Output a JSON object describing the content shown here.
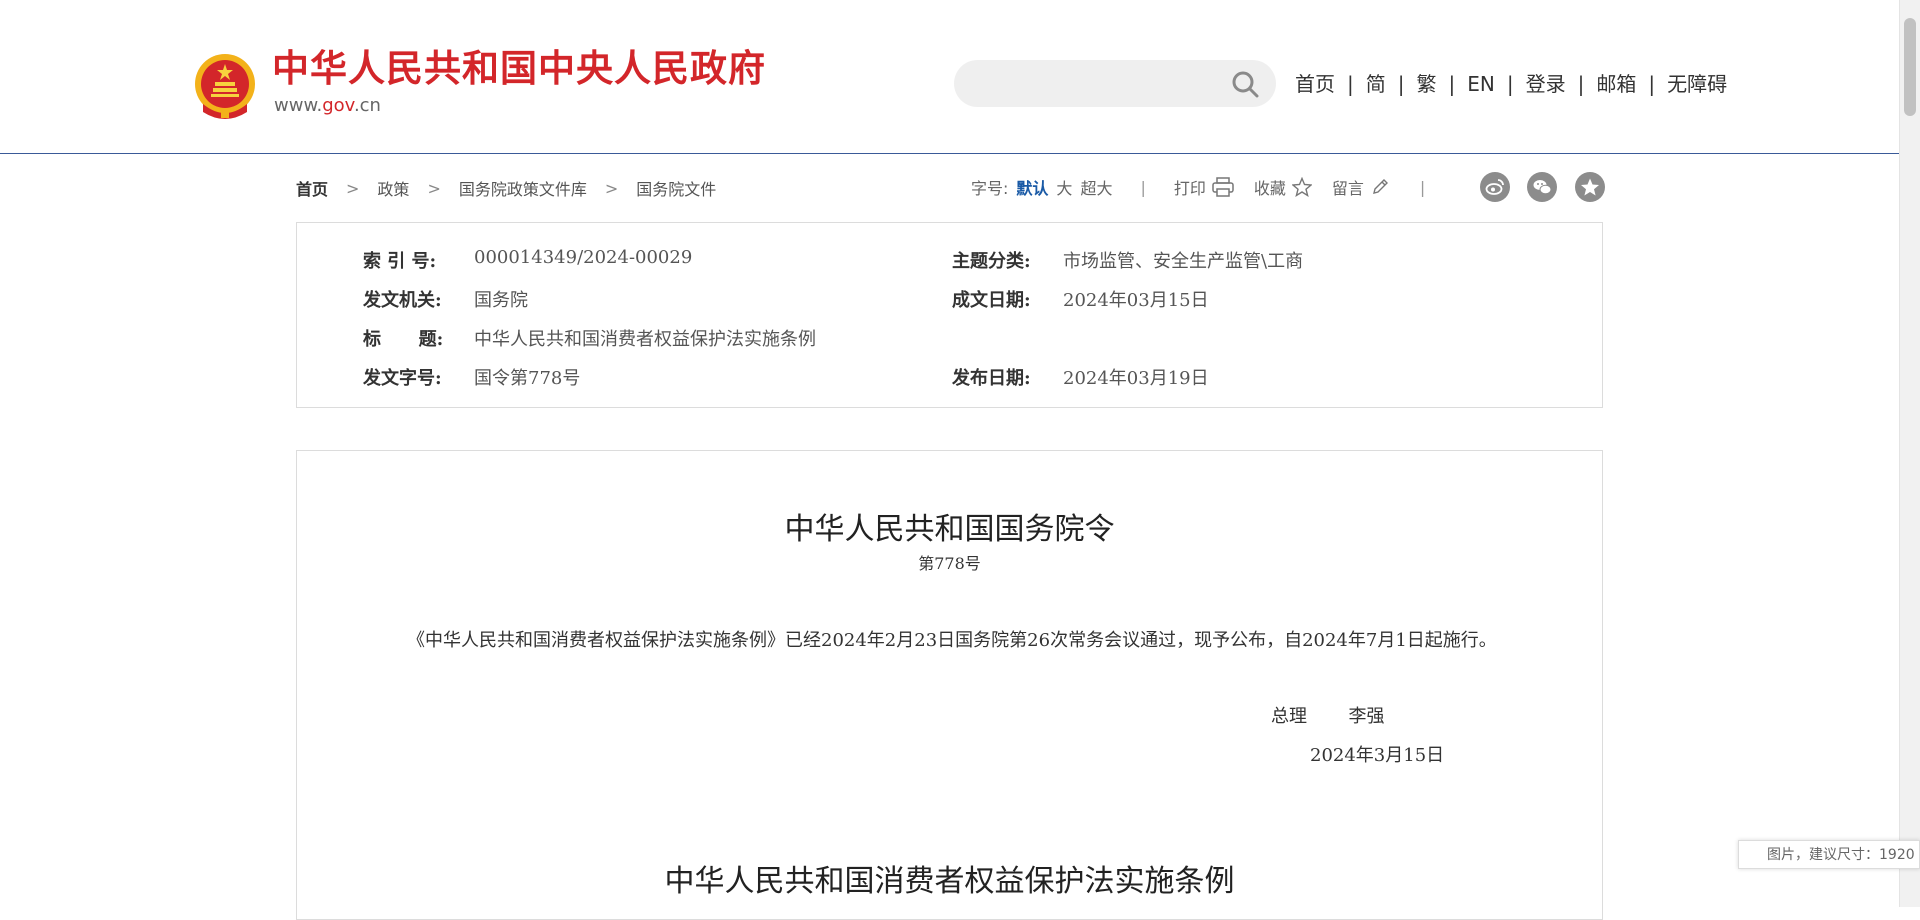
{
  "header": {
    "site_name": "中华人民共和国中央人民政府",
    "site_url_prefix": "www.",
    "site_url_domain": "gov",
    "site_url_suffix": ".cn",
    "search_placeholder": "",
    "nav": [
      "首页",
      "简",
      "繁",
      "EN",
      "登录",
      "邮箱",
      "无障碍"
    ],
    "nav_separator": "|",
    "brand_color": "#d3262a",
    "rule_color": "#3a5a98"
  },
  "breadcrumb": {
    "items": [
      "首页",
      "政策",
      "国务院政策文件库",
      "国务院文件"
    ],
    "arrow": ">"
  },
  "toolbar": {
    "font_label": "字号:",
    "font_default": "默认",
    "font_large": "大",
    "font_xlarge": "超大",
    "separator": "|",
    "print": "打印",
    "favorite": "收藏",
    "comment": "留言",
    "share_icons": [
      "weibo-icon",
      "wechat-icon",
      "star-share-icon"
    ]
  },
  "info": {
    "index_label": "索  引  号:",
    "index_value": "000014349/2024-00029",
    "category_label": "主题分类:",
    "category_value": "市场监管、安全生产监管\\工商",
    "issuer_label": "发文机关:",
    "issuer_value": "国务院",
    "created_label": "成文日期:",
    "created_value": "2024年03月15日",
    "title_label": "标      题:",
    "title_value": "中华人民共和国消费者权益保护法实施条例",
    "docno_label": "发文字号:",
    "docno_value": "国令第778号",
    "published_label": "发布日期:",
    "published_value": "2024年03月19日"
  },
  "article": {
    "title": "中华人民共和国国务院令",
    "subtitle": "第778号",
    "paragraph": "《中华人民共和国消费者权益保护法实施条例》已经2024年2月23日国务院第26次常务会议通过，现予公布，自2024年7月1日起施行。",
    "signature_role": "总理",
    "signature_name": "李强",
    "date": "2024年3月15日",
    "title2": "中华人民共和国消费者权益保护法实施条例"
  },
  "tooltip": {
    "text": "图片，建议尺寸：1920"
  }
}
